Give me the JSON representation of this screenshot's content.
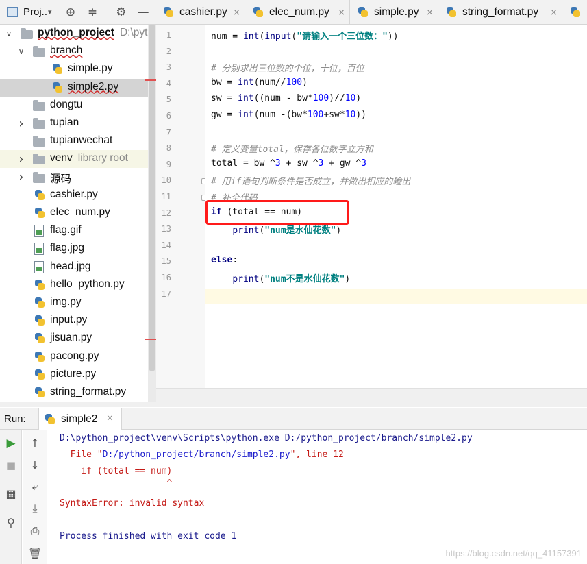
{
  "project_panel": {
    "title": "Proj..",
    "icons": [
      "locate-icon",
      "collapse-icon",
      "gear-icon",
      "minimize-icon"
    ],
    "tree": [
      {
        "label": "python_project",
        "extra": "D:\\pytho",
        "kind": "folder",
        "expanded": true,
        "depth": 0
      },
      {
        "label": "branch",
        "kind": "folder",
        "expanded": true,
        "depth": 1
      },
      {
        "label": "simple.py",
        "kind": "py",
        "depth": 2
      },
      {
        "label": "simple2.py",
        "kind": "py",
        "depth": 2,
        "selected": true
      },
      {
        "label": "dongtu",
        "kind": "folder",
        "depth": 1
      },
      {
        "label": "tupian",
        "kind": "folder",
        "expanded": false,
        "depth": 1
      },
      {
        "label": "tupianwechat",
        "kind": "folder",
        "depth": 1
      },
      {
        "label": "venv",
        "extra": "library root",
        "kind": "folder",
        "expanded": false,
        "depth": 1
      },
      {
        "label": "源码",
        "kind": "folder",
        "expanded": false,
        "depth": 1
      },
      {
        "label": "cashier.py",
        "kind": "py",
        "depth": 1
      },
      {
        "label": "elec_num.py",
        "kind": "py",
        "depth": 1
      },
      {
        "label": "flag.gif",
        "kind": "img",
        "depth": 1
      },
      {
        "label": "flag.jpg",
        "kind": "img",
        "depth": 1
      },
      {
        "label": "head.jpg",
        "kind": "img",
        "depth": 1
      },
      {
        "label": "hello_python.py",
        "kind": "py",
        "depth": 1
      },
      {
        "label": "img.py",
        "kind": "py",
        "depth": 1
      },
      {
        "label": "input.py",
        "kind": "py",
        "depth": 1
      },
      {
        "label": "jisuan.py",
        "kind": "py",
        "depth": 1
      },
      {
        "label": "pacong.py",
        "kind": "py",
        "depth": 1
      },
      {
        "label": "picture.py",
        "kind": "py",
        "depth": 1
      },
      {
        "label": "string_format.py",
        "kind": "py",
        "depth": 1
      }
    ]
  },
  "editor_tabs": [
    {
      "label": "cashier.py",
      "close": "×"
    },
    {
      "label": "elec_num.py",
      "close": "×"
    },
    {
      "label": "simple.py",
      "close": "×"
    },
    {
      "label": "string_format.py",
      "close": "×"
    }
  ],
  "editor": {
    "line_numbers": [
      "1",
      "2",
      "3",
      "4",
      "5",
      "6",
      "7",
      "8",
      "9",
      "10",
      "11",
      "12",
      "13",
      "14",
      "15",
      "16",
      "17"
    ],
    "current_line": 17,
    "lines": [
      "num = int(input(\"请输入一个三位数：\"))",
      "",
      "# 分别求出三位数的个位，十位，百位",
      "bw = int(num//100)",
      "sw = int((num - bw*100)//10)",
      "gw = int(num -(bw*100+sw*10))",
      "",
      "# 定义变量total，保存各位数字立方和",
      "total = bw ^3 + sw ^3 + gw ^3",
      "# 用if语句判断条件是否成立，并做出相应的输出",
      "# 补全代码",
      "if (total == num)",
      "    print(\"num是水仙花数\")",
      "",
      "else:",
      "    print(\"num不是水仙花数\")",
      ""
    ]
  },
  "run_panel": {
    "label": "Run:",
    "tab_label": "simple2",
    "tab_close": "×",
    "tools_left": [
      "run-icon",
      "stop-icon",
      "layout-icon",
      "pin-icon"
    ],
    "tools_right": [
      "up-arrow-icon",
      "down-arrow-icon",
      "soft-wrap-icon",
      "scroll-to-end-icon",
      "print-icon",
      "trash-icon"
    ],
    "console": {
      "cmd": "D:\\python_project\\venv\\Scripts\\python.exe D:/python_project/branch/simple2.py",
      "file_prefix": "  File \"",
      "file_link": "D:/python_project/branch/simple2.py",
      "file_suffix": "\", line 12",
      "code_line": "    if (total == num)",
      "caret": "                    ^",
      "error": "SyntaxError: invalid syntax",
      "finished": "Process finished with exit code 1"
    }
  },
  "watermark": "https://blog.csdn.net/qq_41157391"
}
